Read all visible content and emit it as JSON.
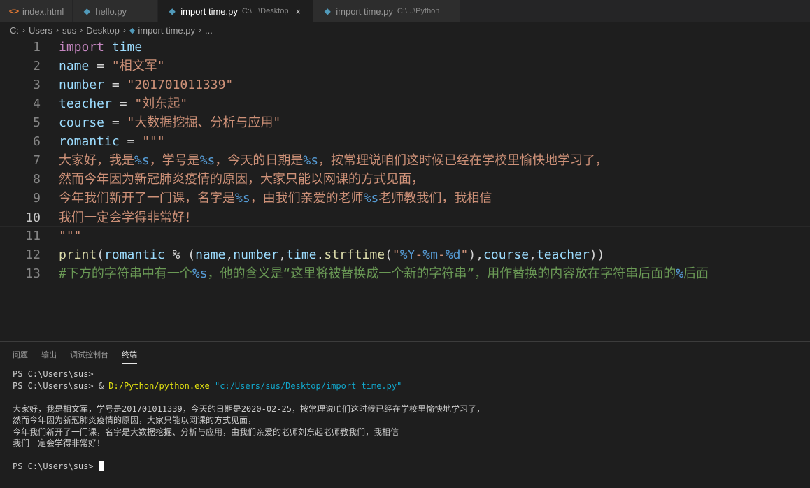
{
  "tabs": [
    {
      "icon": "html-file-icon",
      "label": "index.html",
      "desc": "",
      "active": false
    },
    {
      "icon": "python-file-icon",
      "label": "hello.py",
      "desc": "",
      "active": false
    },
    {
      "icon": "python-file-icon",
      "label": "import time.py",
      "desc": "C:\\...\\Desktop",
      "active": true,
      "close": "×"
    },
    {
      "icon": "python-file-icon",
      "label": "import time.py",
      "desc": "C:\\...\\Python",
      "active": false
    }
  ],
  "breadcrumb": [
    "C:",
    "Users",
    "sus",
    "Desktop",
    "import time.py",
    "..."
  ],
  "editor": {
    "current_line": 10,
    "lines": [
      {
        "n": "1",
        "t": [
          [
            "kw",
            "import"
          ],
          [
            "tx",
            " "
          ],
          [
            "id",
            "time"
          ]
        ]
      },
      {
        "n": "2",
        "t": [
          [
            "id",
            "name"
          ],
          [
            "tx",
            " = "
          ],
          [
            "str",
            "\"相文军\""
          ]
        ]
      },
      {
        "n": "3",
        "t": [
          [
            "id",
            "number"
          ],
          [
            "tx",
            " = "
          ],
          [
            "str",
            "\"201701011339\""
          ]
        ]
      },
      {
        "n": "4",
        "t": [
          [
            "id",
            "teacher"
          ],
          [
            "tx",
            " = "
          ],
          [
            "str",
            "\"刘东起\""
          ]
        ]
      },
      {
        "n": "5",
        "t": [
          [
            "id",
            "course"
          ],
          [
            "tx",
            " = "
          ],
          [
            "str",
            "\"大数据挖掘、分析与应用\""
          ]
        ]
      },
      {
        "n": "6",
        "t": [
          [
            "id",
            "romantic"
          ],
          [
            "tx",
            " = "
          ],
          [
            "str",
            "\"\"\""
          ]
        ]
      },
      {
        "n": "7",
        "t": [
          [
            "str",
            "大家好，我是"
          ],
          [
            "esc",
            "%s"
          ],
          [
            "str",
            "，学号是"
          ],
          [
            "esc",
            "%s"
          ],
          [
            "str",
            "，今天的日期是"
          ],
          [
            "esc",
            "%s"
          ],
          [
            "str",
            "，按常理说咱们这时候已经在学校里愉快地学习了，"
          ]
        ]
      },
      {
        "n": "8",
        "t": [
          [
            "str",
            "然而今年因为新冠肺炎疫情的原因，大家只能以网课的方式见面，"
          ]
        ]
      },
      {
        "n": "9",
        "t": [
          [
            "str",
            "今年我们新开了一门课，名字是"
          ],
          [
            "esc",
            "%s"
          ],
          [
            "str",
            "，由我们亲爱的老师"
          ],
          [
            "esc",
            "%s"
          ],
          [
            "str",
            "老师教我们，我相信"
          ]
        ]
      },
      {
        "n": "10",
        "t": [
          [
            "str",
            "我们一定会学得非常好！"
          ]
        ]
      },
      {
        "n": "11",
        "t": [
          [
            "str",
            "\"\"\""
          ]
        ]
      },
      {
        "n": "12",
        "t": [
          [
            "fn",
            "print"
          ],
          [
            "tx",
            "("
          ],
          [
            "id",
            "romantic"
          ],
          [
            "tx",
            " % ("
          ],
          [
            "id",
            "name"
          ],
          [
            "tx",
            ","
          ],
          [
            "id",
            "number"
          ],
          [
            "tx",
            ","
          ],
          [
            "id",
            "time"
          ],
          [
            "tx",
            "."
          ],
          [
            "fn",
            "strftime"
          ],
          [
            "tx",
            "("
          ],
          [
            "str",
            "\""
          ],
          [
            "esc",
            "%Y"
          ],
          [
            "str",
            "-"
          ],
          [
            "esc",
            "%m"
          ],
          [
            "str",
            "-"
          ],
          [
            "esc",
            "%d"
          ],
          [
            "str",
            "\""
          ],
          [
            "tx",
            "),"
          ],
          [
            "id",
            "course"
          ],
          [
            "tx",
            ","
          ],
          [
            "id",
            "teacher"
          ],
          [
            "tx",
            "))"
          ]
        ]
      },
      {
        "n": "13",
        "t": [
          [
            "cm",
            "#下方的字符串中有一个"
          ],
          [
            "cesc",
            "%s"
          ],
          [
            "cm",
            "，他的含义是“这里将被替换成一个新的字符串”，用作替换的内容放在字符串后面的"
          ],
          [
            "cesc",
            "%"
          ],
          [
            "cm",
            "后面"
          ]
        ]
      }
    ]
  },
  "panel": {
    "tabs": [
      "问题",
      "输出",
      "调试控制台",
      "终端"
    ],
    "active_tab": 3,
    "terminal": {
      "line1": "PS C:\\Users\\sus>",
      "line2_prompt": "PS C:\\Users\\sus> ",
      "line2_op": "& ",
      "line2_exe": "D:/Python/python.exe",
      "line2_arg": " \"c:/Users/sus/Desktop/import time.py\"",
      "output": [
        "大家好，我是相文军，学号是201701011339，今天的日期是2020-02-25，按常理说咱们这时候已经在学校里愉快地学习了，",
        "然而今年因为新冠肺炎疫情的原因，大家只能以网课的方式见面，",
        "今年我们新开了一门课，名字是大数据挖掘、分析与应用，由我们亲爱的老师刘东起老师教我们，我相信",
        "我们一定会学得非常好！"
      ],
      "last_prompt": "PS C:\\Users\\sus> "
    }
  }
}
